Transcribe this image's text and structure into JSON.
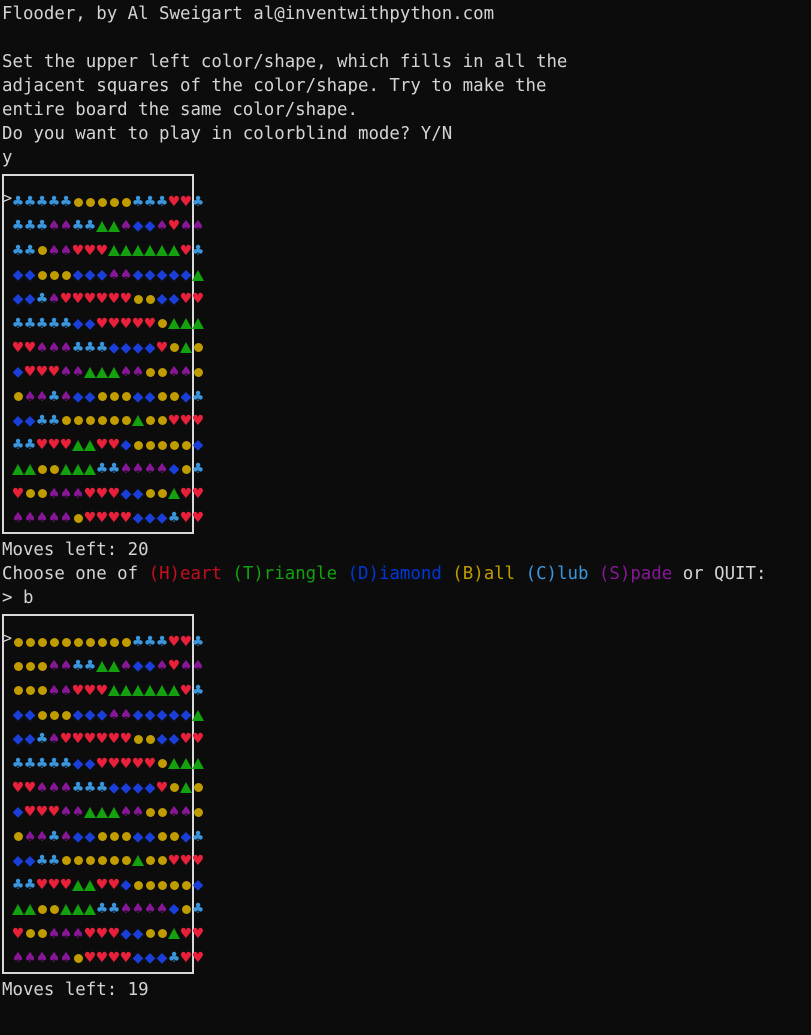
{
  "header": {
    "title_line": "Flooder, by Al Sweigart al@inventwithpython.com",
    "instructions": [
      "Set the upper left color/shape, which fills in all the",
      "adjacent squares of the color/shape. Try to make the",
      "entire board the same color/shape."
    ],
    "colorblind_prompt": "Do you want to play in colorblind mode? Y/N",
    "colorblind_answer": "y"
  },
  "legend": {
    "H": {
      "glyph": "heart",
      "color": "#e8203a"
    },
    "T": {
      "glyph": "triangle",
      "color": "#13a10e"
    },
    "D": {
      "glyph": "diamond",
      "color": "#1a3ed8"
    },
    "B": {
      "glyph": "ball",
      "color": "#c19c00"
    },
    "C": {
      "glyph": "club",
      "color": "#3a96dd"
    },
    "S": {
      "glyph": "spade",
      "color": "#881798"
    }
  },
  "boards": [
    {
      "cursor": ">",
      "rows": [
        "CCCCCBBBBBCCCHHC",
        "CCCSSCCTTSDDSHSS",
        "CCBSSHHHTTTTTTHC",
        "DDBBBDDDSSDDDDDT",
        "DDCSHHHHHHBBDDHH",
        "CCCCCDDHHHHHBTTT",
        "HHSSSCCCDDDDHBTB",
        "DHHHSSTTTSSBBSSB",
        "BSSCSDDBBBDDBBDC",
        "DDCCBBBBBBTBBHHH",
        "CCHHHTTHHDBBBBBD",
        "TTBBTTTCCSSSSDBC",
        "HBBSSSHHHDDBBTHH",
        "SSSSSBHHHHDDDCHH"
      ]
    },
    {
      "cursor": ">",
      "rows": [
        "BBBBBBBBBBCCCHHC",
        "BBBSSCCTTSDDSHSS",
        "BBBSSHHHTTTTTTHC",
        "DDBBBDDDSSDDDDDT",
        "DDCSHHHHHHBBDDHH",
        "CCCCCDDHHHHHBTTT",
        "HHSSSCCCDDDDHBTB",
        "DHHHSSTTTSSBBSSB",
        "BSSCSDDBBBDDBBDC",
        "DDCCBBBBBBTBBHHH",
        "CCHHHTTHHDBBBBBD",
        "TTBBTTTCCSSSSDBC",
        "HBBSSSHHHDDBBTHH",
        "SSSSSBHHHHDDDCHH"
      ]
    }
  ],
  "turn1": {
    "moves_left": "Moves left: 20",
    "choose_prefix": "Choose one of ",
    "options": [
      {
        "label": "(H)eart",
        "key": "heart"
      },
      {
        "label": "(T)riangle",
        "key": "triangle"
      },
      {
        "label": "(D)iamond",
        "key": "diamond"
      },
      {
        "label": "(B)all",
        "key": "ball"
      },
      {
        "label": "(C)lub",
        "key": "club"
      },
      {
        "label": "(S)pade",
        "key": "spade"
      }
    ],
    "choose_suffix": "or QUIT:",
    "input": "> b"
  },
  "turn2": {
    "moves_left": "Moves left: 19"
  }
}
